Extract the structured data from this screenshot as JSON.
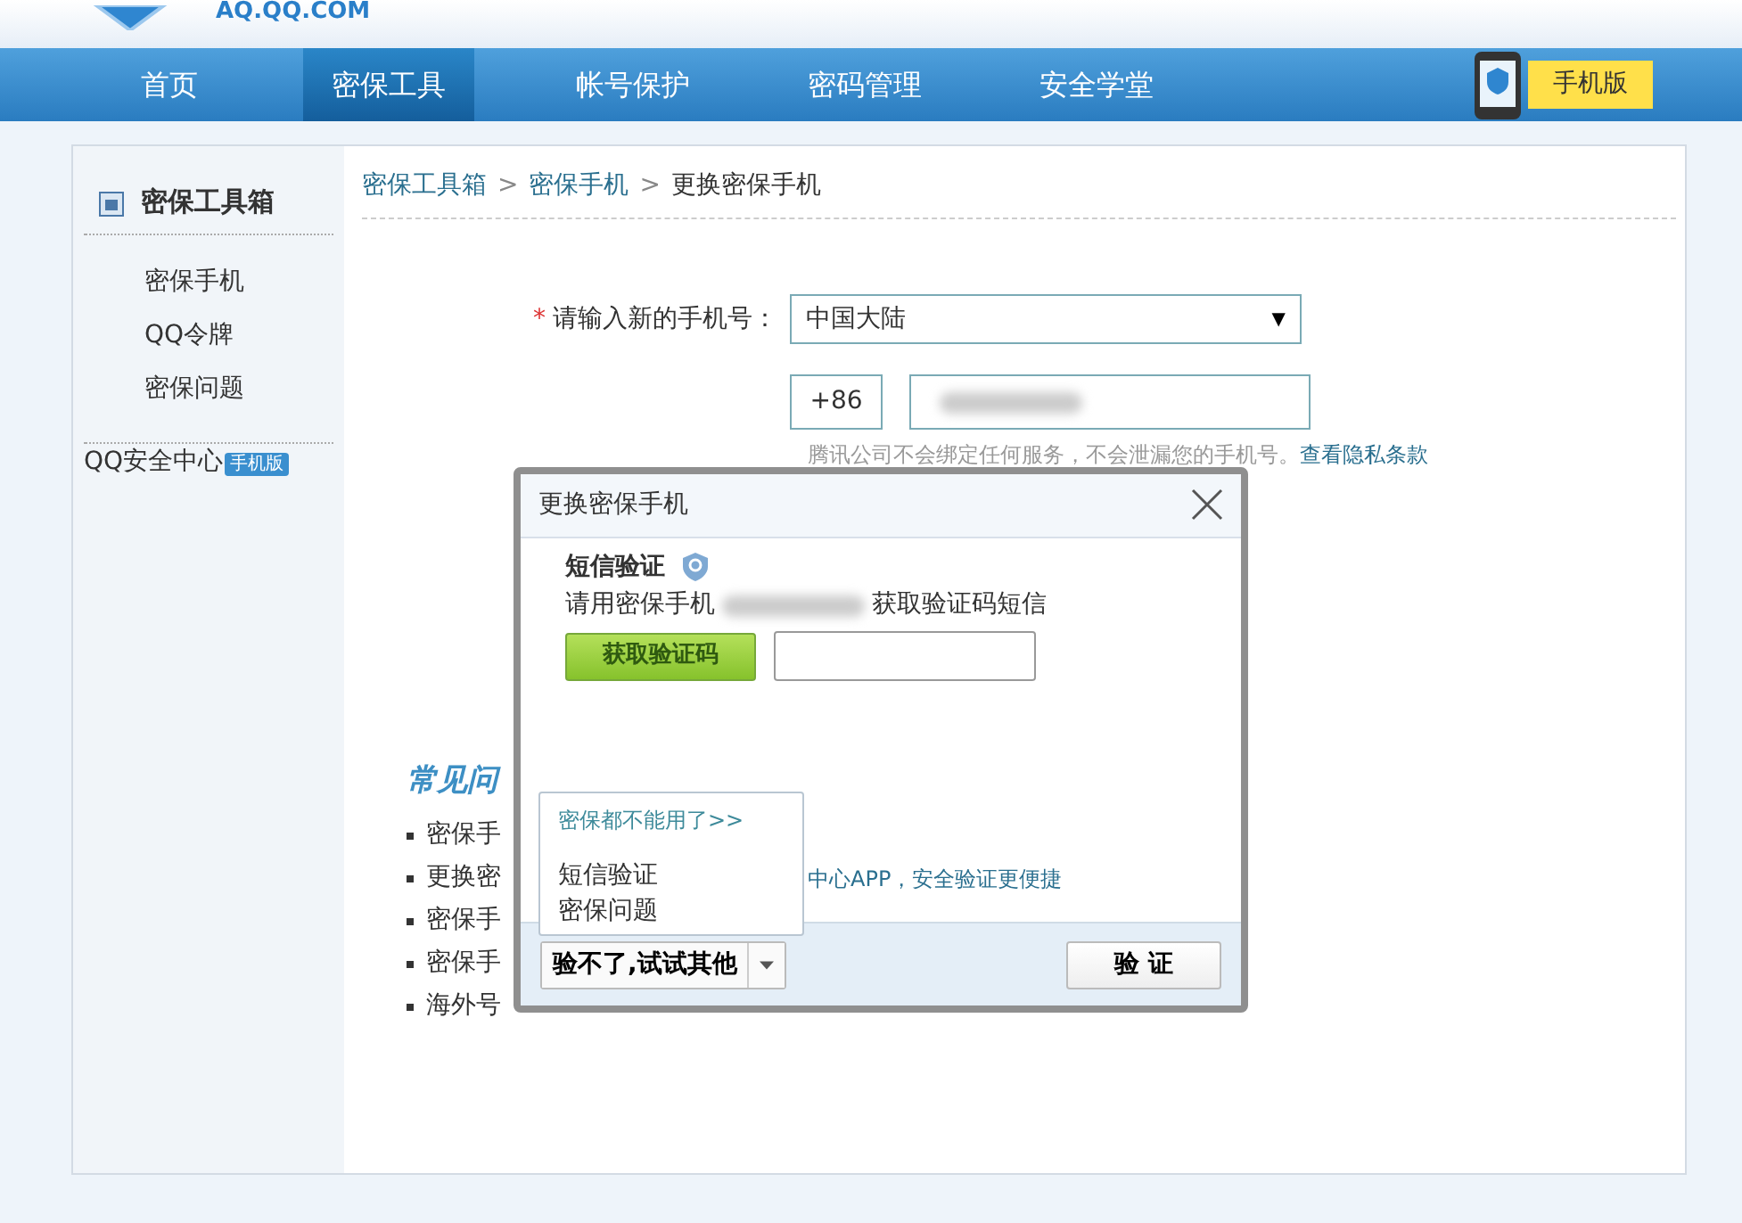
{
  "header": {
    "site": "AQ.QQ.COM"
  },
  "nav": {
    "items": [
      {
        "label": "首页",
        "selected": false
      },
      {
        "label": "密保工具",
        "selected": true
      },
      {
        "label": "帐号保护",
        "selected": false
      },
      {
        "label": "密码管理",
        "selected": false
      },
      {
        "label": "安全学堂",
        "selected": false
      }
    ],
    "mobile_tag": "手机版"
  },
  "sidebar": {
    "title": "密保工具箱",
    "items": [
      "密保手机",
      "QQ令牌",
      "密保问题"
    ],
    "app_link": {
      "label": "QQ安全中心",
      "badge": "手机版"
    }
  },
  "breadcrumb": {
    "separator": ">",
    "items": [
      {
        "label": "密保工具箱",
        "link": true
      },
      {
        "label": "密保手机",
        "link": true
      },
      {
        "label": "更换密保手机",
        "link": false
      }
    ]
  },
  "form": {
    "required_mark": "*",
    "label": "请输入新的手机号：",
    "region": "中国大陆",
    "dropdown_arrow": "▼",
    "country_code": "+86",
    "hint": "腾讯公司不会绑定任何服务，不会泄漏您的手机号。",
    "privacy_link": "查看隐私条款"
  },
  "faq": {
    "title": "常见问",
    "items": [
      "密保手",
      "更换密",
      "密保手",
      "密保手",
      "海外号"
    ],
    "link": "中心APP，安全验证更便捷"
  },
  "dialog": {
    "title": "更换密保手机",
    "section_title": "短信验证",
    "instruction_before": "请用密保手机",
    "instruction_after": "获取验证码短信",
    "get_code_button": "获取验证码",
    "fallback_button": "验不了,试试其他",
    "verify_button": "验 证",
    "menu": {
      "header": "密保都不能用了>>",
      "items": [
        "短信验证",
        "密保问题"
      ]
    }
  }
}
